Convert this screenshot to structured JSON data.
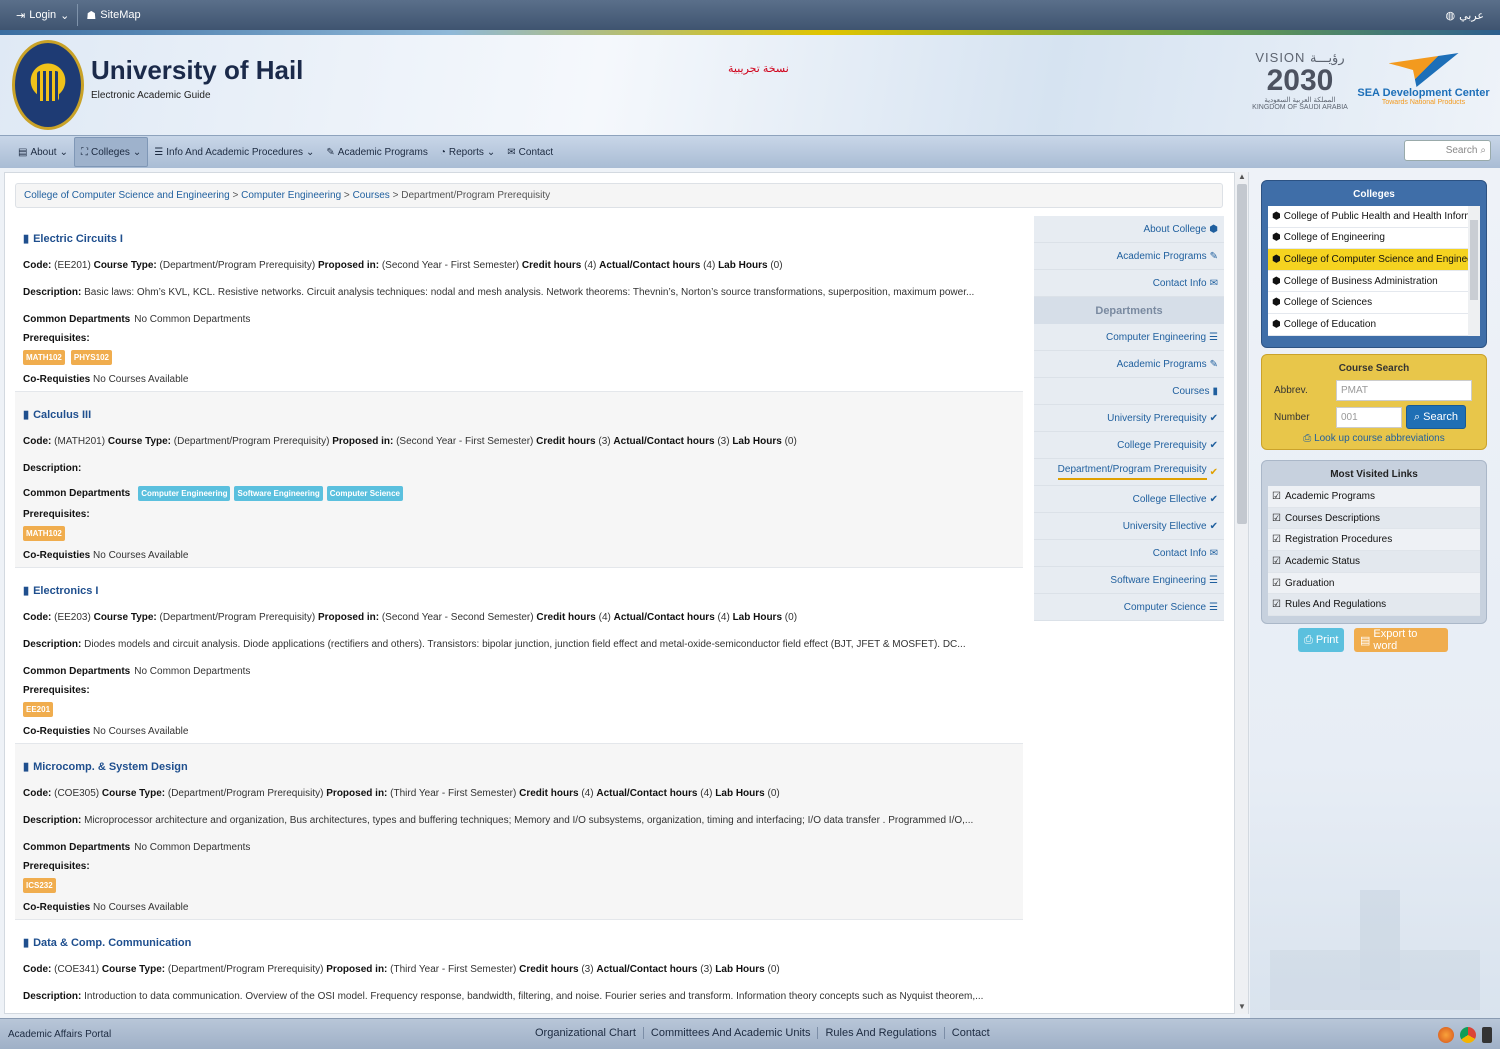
{
  "topbar": {
    "login": "Login",
    "sitemap": "SiteMap",
    "language": "عربي"
  },
  "header": {
    "title": "University of Hail",
    "subtitle": "Electronic Academic Guide",
    "trial_text": "نسخة تجريبية",
    "vision": {
      "line1": "VISION رؤيـــة",
      "year": "2030",
      "line3": "المملكة العربية السعودية",
      "line4": "KINGDOM OF SAUDI ARABIA"
    },
    "sea": {
      "name": "SEA Development Center",
      "tagline": "Towards National Products"
    }
  },
  "nav": {
    "items": [
      {
        "label": "About",
        "icon": "document-icon",
        "dropdown": true
      },
      {
        "label": "Colleges",
        "icon": "cubes-icon",
        "dropdown": true,
        "active": true
      },
      {
        "label": "Info And Academic Procedures",
        "icon": "list-icon",
        "dropdown": true
      },
      {
        "label": "Academic Programs",
        "icon": "pencil-icon",
        "dropdown": false
      },
      {
        "label": "Reports",
        "icon": "chart-icon",
        "dropdown": true
      },
      {
        "label": "Contact",
        "icon": "envelope-icon",
        "dropdown": false
      }
    ],
    "search_placeholder": "Search"
  },
  "breadcrumb": {
    "items": [
      "College of Computer Science and Engineering",
      "Computer Engineering",
      "Courses"
    ],
    "current": "Department/Program Prerequisity"
  },
  "labels": {
    "code": "Code:",
    "course_type": "Course Type:",
    "proposed_in": "Proposed in:",
    "credit_hours": "Credit hours",
    "contact_hours": "Actual/Contact hours",
    "lab_hours": "Lab Hours",
    "description": "Description:",
    "common_departments": "Common Departments",
    "prerequisites": "Prerequisites:",
    "corequisites": "Co-Requisties"
  },
  "courses": [
    {
      "title": "Electric Circuits I",
      "code": "(EE201)",
      "type": "(Department/Program Prerequisity)",
      "proposed": "(Second Year - First Semester)",
      "credit": "(4)",
      "contact": "(4)",
      "lab": "(0)",
      "description": "Basic laws: Ohm’s KVL, KCL. Resistive networks. Circuit analysis techniques: nodal and mesh analysis. Network theorems: Thevnin’s, Norton’s source transformations, superposition, maximum power...",
      "common": "No Common Departments",
      "common_tags": [],
      "prereqs": [
        "MATH102",
        "PHYS102"
      ],
      "coreq": "No Courses Available"
    },
    {
      "title": "Calculus III",
      "code": "(MATH201)",
      "type": "(Department/Program Prerequisity)",
      "proposed": "(Second Year - First Semester)",
      "credit": "(3)",
      "contact": "(3)",
      "lab": "(0)",
      "description": "",
      "common": "",
      "common_tags": [
        "Computer Engineering",
        "Software Engineering",
        "Computer Science"
      ],
      "prereqs": [
        "MATH102"
      ],
      "coreq": "No Courses Available"
    },
    {
      "title": "Electronics I",
      "code": "(EE203)",
      "type": "(Department/Program Prerequisity)",
      "proposed": "(Second Year - Second Semester)",
      "credit": "(4)",
      "contact": "(4)",
      "lab": "(0)",
      "description": "Diodes models and circuit analysis. Diode applications (rectifiers and others). Transistors: bipolar junction, junction field effect and metal-oxide-semiconductor field effect (BJT, JFET & MOSFET). DC...",
      "common": "No Common Departments",
      "common_tags": [],
      "prereqs": [
        "EE201"
      ],
      "coreq": "No Courses Available"
    },
    {
      "title": "Microcomp. & System Design",
      "code": "(COE305)",
      "type": "(Department/Program Prerequisity)",
      "proposed": "(Third Year - First Semester)",
      "credit": "(4)",
      "contact": "(4)",
      "lab": "(0)",
      "description": "Microprocessor architecture and organization, Bus architectures, types and buffering techniques; Memory and I/O subsystems, organization, timing and interfacing; I/O data transfer . Programmed I/O,...",
      "common": "No Common Departments",
      "common_tags": [],
      "prereqs": [
        "ICS232"
      ],
      "coreq": "No Courses Available"
    },
    {
      "title": "Data & Comp. Communication",
      "code": "(COE341)",
      "type": "(Department/Program Prerequisity)",
      "proposed": "(Third Year - First Semester)",
      "credit": "(3)",
      "contact": "(3)",
      "lab": "(0)",
      "description": "Introduction to data communication. Overview of the OSI model. Frequency response, bandwidth, filtering, and noise. Fourier series and transform. Information theory concepts such as Nyquist theorem,...",
      "common": "",
      "common_tags": [],
      "prereqs": [],
      "coreq": ""
    }
  ],
  "sidebar": {
    "top_links": [
      {
        "label": "About College",
        "icon": "cube-icon"
      },
      {
        "label": "Academic Programs",
        "icon": "pencil-icon"
      },
      {
        "label": "Contact Info",
        "icon": "envelope-icon"
      }
    ],
    "departments_heading": "Departments",
    "dept_links": [
      {
        "label": "Computer Engineering",
        "icon": "list-icon"
      },
      {
        "label": "Academic Programs",
        "icon": "pencil-icon"
      },
      {
        "label": "Courses",
        "icon": "book-icon"
      },
      {
        "label": "University Prerequisity",
        "icon": "check-icon"
      },
      {
        "label": "College Prerequisity",
        "icon": "check-icon"
      },
      {
        "label": "Department/Program Prerequisity",
        "icon": "check-icon",
        "active": true
      },
      {
        "label": "College Ellective",
        "icon": "check-icon"
      },
      {
        "label": "University Ellective",
        "icon": "check-icon"
      },
      {
        "label": "Contact Info",
        "icon": "envelope-icon"
      },
      {
        "label": "Software Engineering",
        "icon": "list-icon"
      },
      {
        "label": "Computer Science",
        "icon": "list-icon"
      }
    ]
  },
  "colleges_panel": {
    "title": "Colleges",
    "items": [
      "College of Public Health and Health Informatics",
      "College of Engineering",
      "College of Computer Science and Engineering",
      "College of Business Administration",
      "College of Sciences",
      "College of Education"
    ],
    "selected_index": 2
  },
  "course_search": {
    "title": "Course Search",
    "abbrev_label": "Abbrev.",
    "abbrev_placeholder": "PMAT",
    "number_label": "Number",
    "number_placeholder": "001",
    "search_button": "Search",
    "lookup": "Look up course abbreviations"
  },
  "most_visited": {
    "title": "Most Visited Links",
    "items": [
      "Academic Programs",
      "Courses Descriptions",
      "Registration Procedures",
      "Academic Status",
      "Graduation",
      "Rules And Regulations"
    ]
  },
  "actions": {
    "print": "Print",
    "export": "Export to word"
  },
  "footer": {
    "portal": "Academic Affairs Portal",
    "links": [
      "Organizational Chart",
      "Committees And Academic Units",
      "Rules And Regulations",
      "Contact"
    ]
  },
  "colors": {
    "accent": "#1f5f9e",
    "prereq_tag": "#f0ad4e",
    "dept_tag": "#5bc0de",
    "selected": "#f5d320"
  }
}
